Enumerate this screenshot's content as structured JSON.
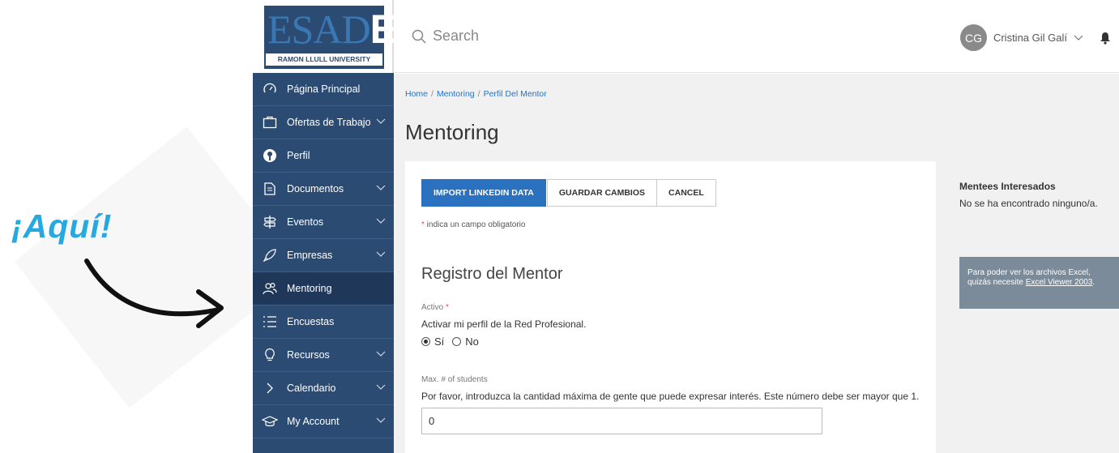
{
  "annotation": {
    "text": "¡Aquí!"
  },
  "logo": {
    "word_a": "ESAD",
    "word_b": "E",
    "subtitle": "RAMON LLULL UNIVERSITY"
  },
  "sidebar": {
    "items": [
      {
        "label": "Página Principal",
        "icon": "speedometer-icon",
        "chevron": false,
        "active": false
      },
      {
        "label": "Ofertas de Trabajo",
        "icon": "briefcase-icon",
        "chevron": true,
        "active": false
      },
      {
        "label": "Perfil",
        "icon": "profile-icon",
        "chevron": false,
        "active": false
      },
      {
        "label": "Documentos",
        "icon": "document-icon",
        "chevron": true,
        "active": false
      },
      {
        "label": "Eventos",
        "icon": "signpost-icon",
        "chevron": true,
        "active": false
      },
      {
        "label": "Empresas",
        "icon": "rocket-icon",
        "chevron": true,
        "active": false
      },
      {
        "label": "Mentoring",
        "icon": "people-icon",
        "chevron": false,
        "active": true
      },
      {
        "label": "Encuestas",
        "icon": "list-icon",
        "chevron": false,
        "active": false
      },
      {
        "label": "Recursos",
        "icon": "lightbulb-icon",
        "chevron": true,
        "active": false
      },
      {
        "label": "Calendario",
        "icon": "chevron-right-icon",
        "chevron": true,
        "active": false
      },
      {
        "label": "My Account",
        "icon": "graduation-cap-icon",
        "chevron": true,
        "active": false
      }
    ]
  },
  "header": {
    "search_placeholder": "Search",
    "user_initials": "CG",
    "user_name": "Cristina Gil Galí"
  },
  "breadcrumb": [
    "Home",
    "Mentoring",
    "Perfil Del Mentor"
  ],
  "breadcrumb_sep": "/",
  "page_title": "Mentoring",
  "buttons": {
    "import": "IMPORT LINKEDIN DATA",
    "save": "GUARDAR CAMBIOS",
    "cancel": "CANCEL"
  },
  "required_note": {
    "star": "*",
    "text": " indica un campo obligatorio"
  },
  "section_title": "Registro del Mentor",
  "active_field": {
    "label": "Activo",
    "star": "*",
    "description": "Activar mi perfil de la Red Profesional.",
    "options": [
      "Sí",
      "No"
    ],
    "selected": "Sí"
  },
  "max_students": {
    "label": "Max. # of students",
    "description": "Por favor, introduzca la cantidad máxima de gente que puede expresar interés. Este número debe ser mayor que 1.",
    "value": "0"
  },
  "mentees": {
    "title": "Mentees Interesados",
    "empty": "No se ha encontrado ninguno/a."
  },
  "excel_note": {
    "text": "Para poder ver los archivos Excel, quizás necesite ",
    "link": "Excel Viewer 2003",
    "end": "."
  },
  "colors": {
    "sidebar": "#2c4b72",
    "accent": "#2a72c0",
    "annotation": "#25a9e0"
  }
}
